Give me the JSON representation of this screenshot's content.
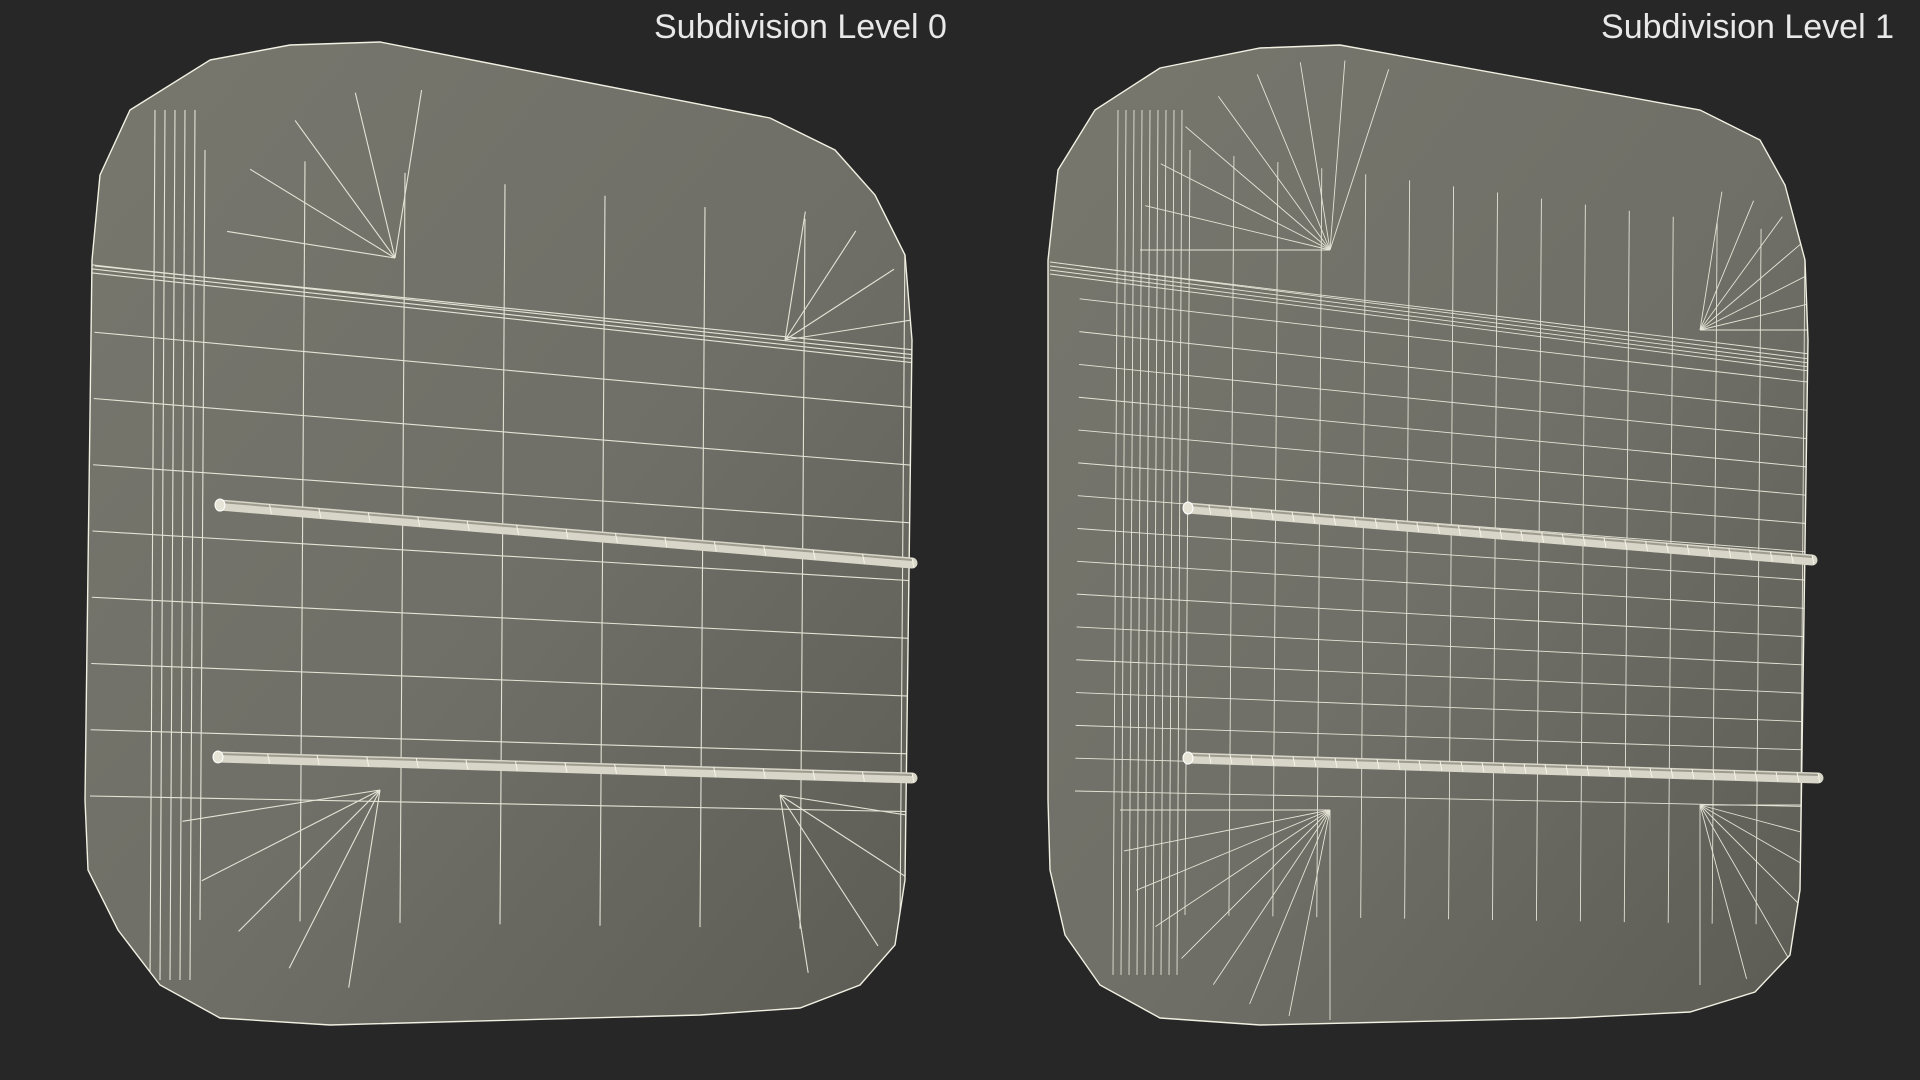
{
  "panels": [
    {
      "label": "Subdivision Level 0",
      "subdivision_level": 0
    },
    {
      "label": "Subdivision Level 1",
      "subdivision_level": 1
    }
  ],
  "colors": {
    "background": "#272727",
    "surface": "#6f6f67",
    "surface_shadow": "#5c5c55",
    "wire": "#f2f0e2",
    "label_text": "#e8e8e8"
  }
}
